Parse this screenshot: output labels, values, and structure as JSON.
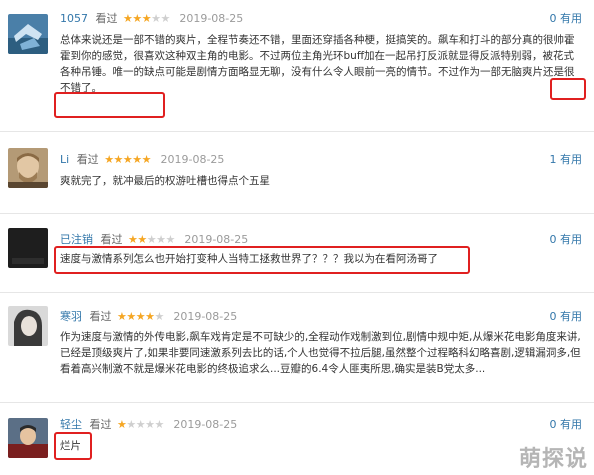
{
  "reviews": [
    {
      "user": "1057",
      "rating_label": "看过",
      "stars": 3,
      "date": "2019-08-25",
      "useful_count": "0",
      "useful_label": "有用",
      "text": "总体来说还是一部不错的爽片，全程节奏还不错，里面还穿插各种梗，挺搞笑的。飙车和打斗的部分真的很帅霍霍到你的感觉，很喜欢这种双主角的电影。不过两位主角光环buff加在一起吊打反派就显得反派特别弱，被花式各种吊锤。唯一的缺点可能是剧情方面略显无聊，没有什么令人眼前一亮的情节。不过作为一部无脑爽片还是很不错了。"
    },
    {
      "user": "Li",
      "rating_label": "看过",
      "stars": 5,
      "date": "2019-08-25",
      "useful_count": "1",
      "useful_label": "有用",
      "text": "爽就完了，就冲最后的权游吐槽也得点个五星"
    },
    {
      "user": "已注销",
      "rating_label": "看过",
      "stars": 2,
      "date": "2019-08-25",
      "useful_count": "0",
      "useful_label": "有用",
      "text": "速度与激情系列怎么也开始打变种人当特工拯救世界了？？？我以为在看阿汤哥了"
    },
    {
      "user": "寒羽",
      "rating_label": "看过",
      "stars": 4,
      "date": "2019-08-25",
      "useful_count": "0",
      "useful_label": "有用",
      "text": "作为速度与激情的外传电影,飙车戏肯定是不可缺少的,全程动作戏制激到位,剧情中规中矩,从爆米花电影角度来讲,已经是顶级爽片了,如果非要同速激系列去比的话,个人也觉得不拉后腿,虽然整个过程略科幻略喜剧,逻辑漏洞多,但看着高兴制激不就是爆米花电影的终极追求么...豆瓣的6.4令人匪夷所思,确实是装B党太多..."
    },
    {
      "user": "轻尘",
      "rating_label": "看过",
      "stars": 1,
      "date": "2019-08-25",
      "useful_count": "0",
      "useful_label": "有用",
      "text": "烂片"
    }
  ],
  "watermark": "萌探说",
  "colors": {
    "link": "#3377aa",
    "star_on": "#f5a623",
    "star_off": "#cfcfcf",
    "highlight": "#e02020"
  }
}
